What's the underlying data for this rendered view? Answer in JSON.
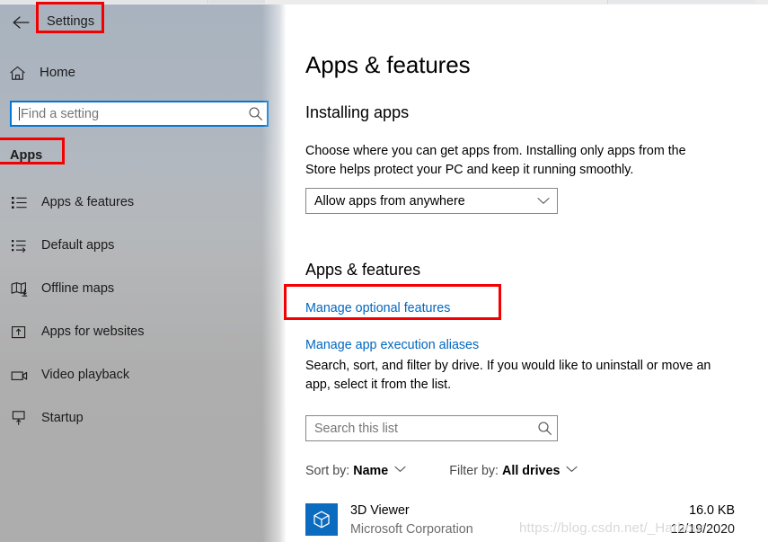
{
  "window": {
    "app_title": "Settings"
  },
  "sidebar": {
    "back_icon": "back-arrow-icon",
    "title": "Settings",
    "home": {
      "label": "Home",
      "icon": "home-icon"
    },
    "search": {
      "placeholder": "Find a setting",
      "value": "",
      "icon": "search-icon"
    },
    "category_header": "Apps",
    "items": [
      {
        "label": "Apps & features",
        "icon": "list-bullets-icon",
        "selected": true
      },
      {
        "label": "Default apps",
        "icon": "list-arrow-icon",
        "selected": false
      },
      {
        "label": "Offline maps",
        "icon": "map-download-icon",
        "selected": false
      },
      {
        "label": "Apps for websites",
        "icon": "window-arrow-icon",
        "selected": false
      },
      {
        "label": "Video playback",
        "icon": "video-camera-icon",
        "selected": false
      },
      {
        "label": "Startup",
        "icon": "monitor-up-icon",
        "selected": false
      }
    ]
  },
  "main": {
    "page_title": "Apps & features",
    "installing": {
      "heading": "Installing apps",
      "description": "Choose where you can get apps from. Installing only apps from the Store helps protect your PC and keep it running smoothly.",
      "dropdown": {
        "value": "Allow apps from anywhere",
        "chevron_icon": "chevron-down-icon"
      }
    },
    "apps_features": {
      "heading": "Apps & features",
      "links": [
        "Manage optional features",
        "Manage app execution aliases"
      ],
      "description": "Search, sort, and filter by drive. If you would like to uninstall or move an app, select it from the list.",
      "search": {
        "placeholder": "Search this list",
        "value": "",
        "icon": "search-icon"
      },
      "sort_by": {
        "label": "Sort by:",
        "value": "Name",
        "chevron_icon": "chevron-down-icon"
      },
      "filter_by": {
        "label": "Filter by:",
        "value": "All drives",
        "chevron_icon": "chevron-down-icon"
      },
      "app_list": [
        {
          "name": "3D Viewer",
          "publisher": "Microsoft Corporation",
          "size": "16.0 KB",
          "date": "12/19/2020",
          "icon": "cube-3d-icon"
        }
      ]
    }
  },
  "watermark": {
    "text": "https://blog.csdn.net/_Harbour"
  },
  "annotations": {
    "color": "#f40000",
    "boxes": [
      {
        "target": "settings-title"
      },
      {
        "target": "apps-category-header"
      },
      {
        "target": "manage-optional-features-link"
      }
    ]
  },
  "colors": {
    "accent_blue": "#0078d7",
    "link_blue": "#0067c0",
    "annotation_red": "#f40000",
    "app_icon_blue": "#0b6cbf",
    "sidebar_top": "#a9b3bf",
    "sidebar_bottom": "#adadad"
  }
}
